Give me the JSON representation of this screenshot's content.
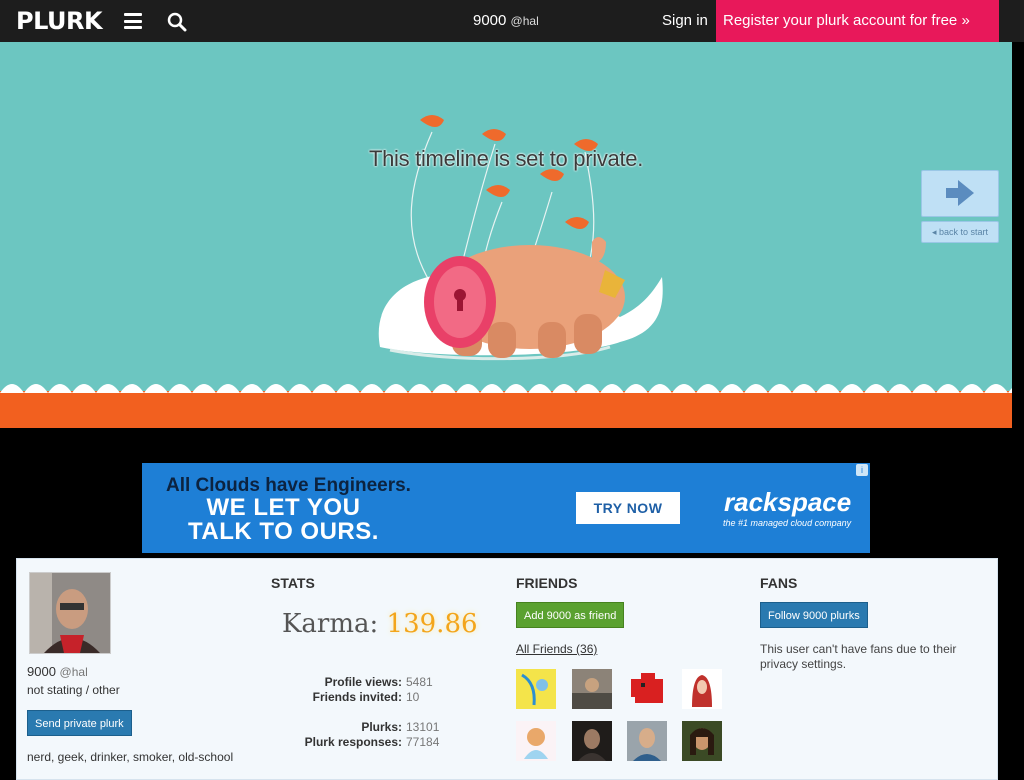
{
  "topbar": {
    "logo": "PLURK",
    "user_display_name": "9000",
    "user_handle": "@hal",
    "signin_label": "Sign in",
    "register_label": "Register your plurk account for free »"
  },
  "banner": {
    "private_message": "This timeline is set to private.",
    "back_to_start_label": "back to start"
  },
  "ad": {
    "line1": "All Clouds have Engineers.",
    "line2a": "WE LET YOU",
    "line2b": "TALK TO OURS.",
    "cta": "TRY NOW",
    "brand": "rackspace",
    "tagline": "the #1 managed cloud company",
    "info_icon": "i"
  },
  "profile": {
    "display_name": "9000",
    "handle": "@hal",
    "status": "not stating / other",
    "private_plurk_button": "Send private plurk",
    "bio": "nerd, geek, drinker, smoker, old-school"
  },
  "stats": {
    "title": "STATS",
    "karma_label": "Karma:",
    "karma_value": "139.86",
    "rows": [
      {
        "key": "Profile views:",
        "value": "5481"
      },
      {
        "key": "Friends invited:",
        "value": "10"
      },
      {
        "key": "Plurks:",
        "value": "13101"
      },
      {
        "key": "Plurk responses:",
        "value": "77184"
      }
    ]
  },
  "friends": {
    "title": "FRIENDS",
    "add_button": "Add 9000 as friend",
    "all_friends_link": "All Friends (36)"
  },
  "fans": {
    "title": "FANS",
    "follow_button": "Follow 9000 plurks",
    "message": "This user can't have fans due to their privacy settings."
  },
  "colors": {
    "topbar_bg": "#1d1d1d",
    "register_bg": "#e8185a",
    "banner_bg": "#6cc6c1",
    "wave_orange": "#f2601f",
    "ad_bg": "#1e7fd6",
    "karma_gold": "#f3a51b",
    "button_blue": "#2a7ab0",
    "button_green": "#5aa130"
  }
}
